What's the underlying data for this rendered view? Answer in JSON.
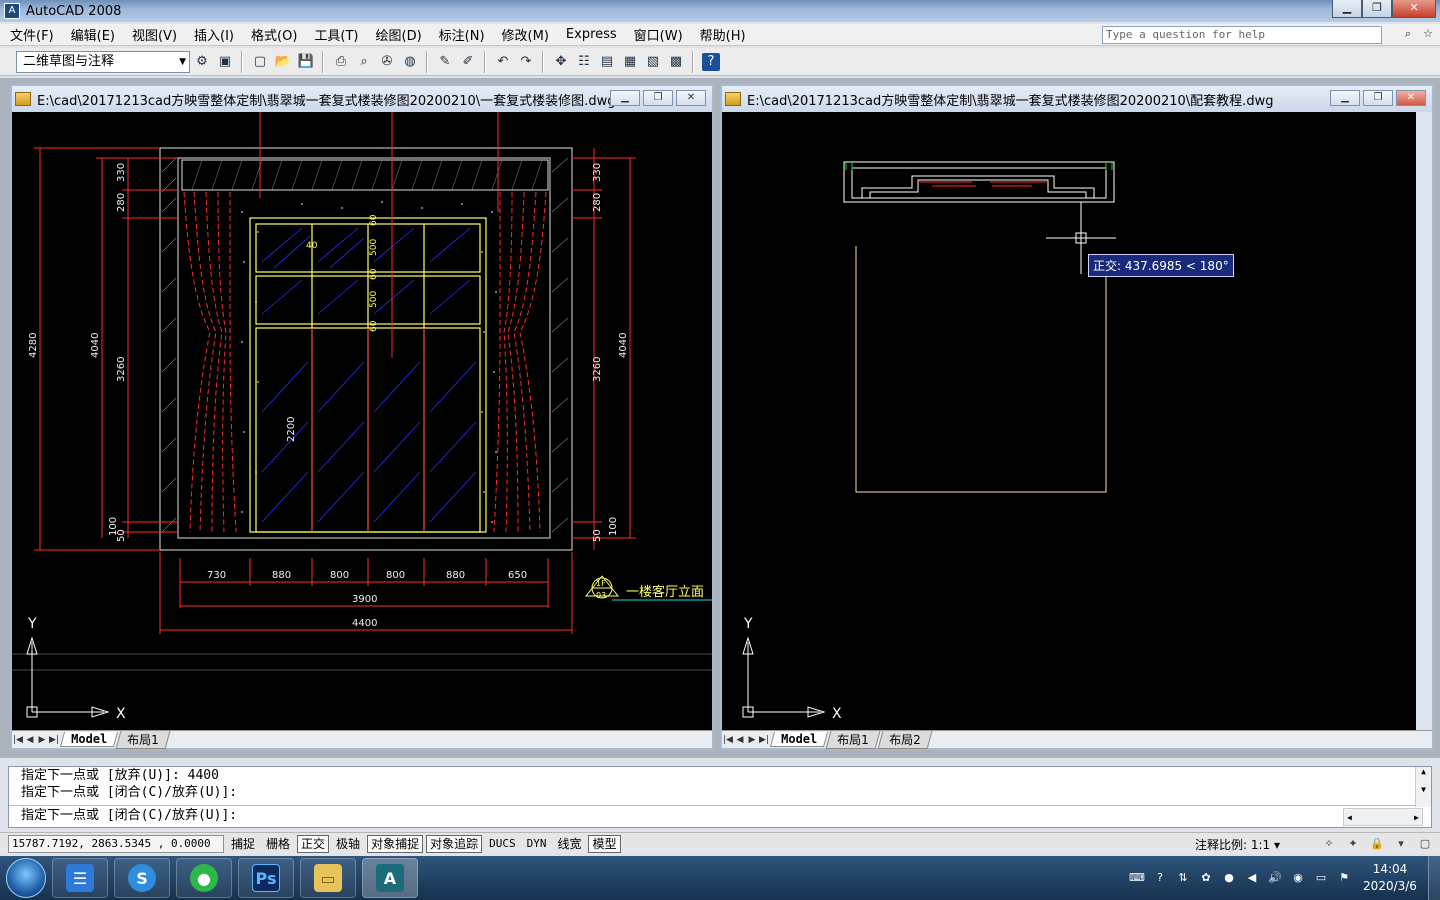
{
  "app": {
    "title": "AutoCAD 2008",
    "icon": "autocad-icon"
  },
  "menu": [
    "文件(F)",
    "编辑(E)",
    "视图(V)",
    "插入(I)",
    "格式(O)",
    "工具(T)",
    "绘图(D)",
    "标注(N)",
    "修改(M)",
    "Express",
    "窗口(W)",
    "帮助(H)"
  ],
  "help": {
    "placeholder": "Type a question for help"
  },
  "toolbar": {
    "workspace": "二维草图与注释"
  },
  "left_doc": {
    "title": "E:\\cad\\20171213cad方映雪整体定制\\翡翠城一套复式楼装修图20200210\\一套复式楼装修图.dwg",
    "tabs": [
      "Model",
      "布局1"
    ],
    "dims": {
      "left_outer": "4280",
      "left_mid": "4040",
      "left_top": "330",
      "left_2": "280",
      "left_3": "3260",
      "left_bot1": "100",
      "left_bot2": "50",
      "right_outer": "4040",
      "right_top": "330",
      "right_2": "280",
      "right_3": "3260",
      "right_bot1": "100",
      "right_bot2": "50",
      "widths": [
        "730",
        "880",
        "800",
        "800",
        "880",
        "650"
      ],
      "inner_width": "3900",
      "outer_width": "4400",
      "inner_v": [
        "60",
        "500",
        "60",
        "500",
        "60"
      ],
      "door_h": "2200",
      "small": "40"
    },
    "label": "一楼客厅立面",
    "tag_top": "1F",
    "tag_bottom": "03"
  },
  "right_doc": {
    "title": "E:\\cad\\20171213cad方映雪整体定制\\翡翠城一套复式楼装修图20200210\\配套教程.dwg",
    "tabs": [
      "Model",
      "布局1",
      "布局2"
    ],
    "tooltip": "正交: 437.6985 < 180°"
  },
  "axis": {
    "x": "X",
    "y": "Y"
  },
  "command": {
    "lines": [
      "指定下一点或 [放弃(U)]: 4400",
      "指定下一点或 [闭合(C)/放弃(U)]:"
    ],
    "prompt": "指定下一点或 [闭合(C)/放弃(U)]:"
  },
  "status": {
    "coords": "15787.7192, 2863.5345 , 0.0000",
    "buttons": [
      {
        "label": "捕捉",
        "on": false
      },
      {
        "label": "栅格",
        "on": false
      },
      {
        "label": "正交",
        "on": true
      },
      {
        "label": "极轴",
        "on": false
      },
      {
        "label": "对象捕捉",
        "on": true
      },
      {
        "label": "对象追踪",
        "on": true
      },
      {
        "label": "DUCS",
        "on": false
      },
      {
        "label": "DYN",
        "on": false
      },
      {
        "label": "线宽",
        "on": false
      },
      {
        "label": "模型",
        "on": true
      }
    ],
    "anno_scale": "注释比例: 1:1 ▾"
  },
  "taskbar": {
    "time": "14:04",
    "date": "2020/3/6",
    "apps": [
      "file-manager-icon",
      "sogou-icon",
      "wechat-icon",
      "photoshop-icon",
      "folder-icon",
      "autocad-icon"
    ]
  },
  "colors": {
    "cad_bg": "#000000",
    "dim_red": "#ff2a2a",
    "line_yellow": "#ffff66",
    "hatch_blue": "#2233ff",
    "tooltip_bg": "#1a2a7a"
  }
}
